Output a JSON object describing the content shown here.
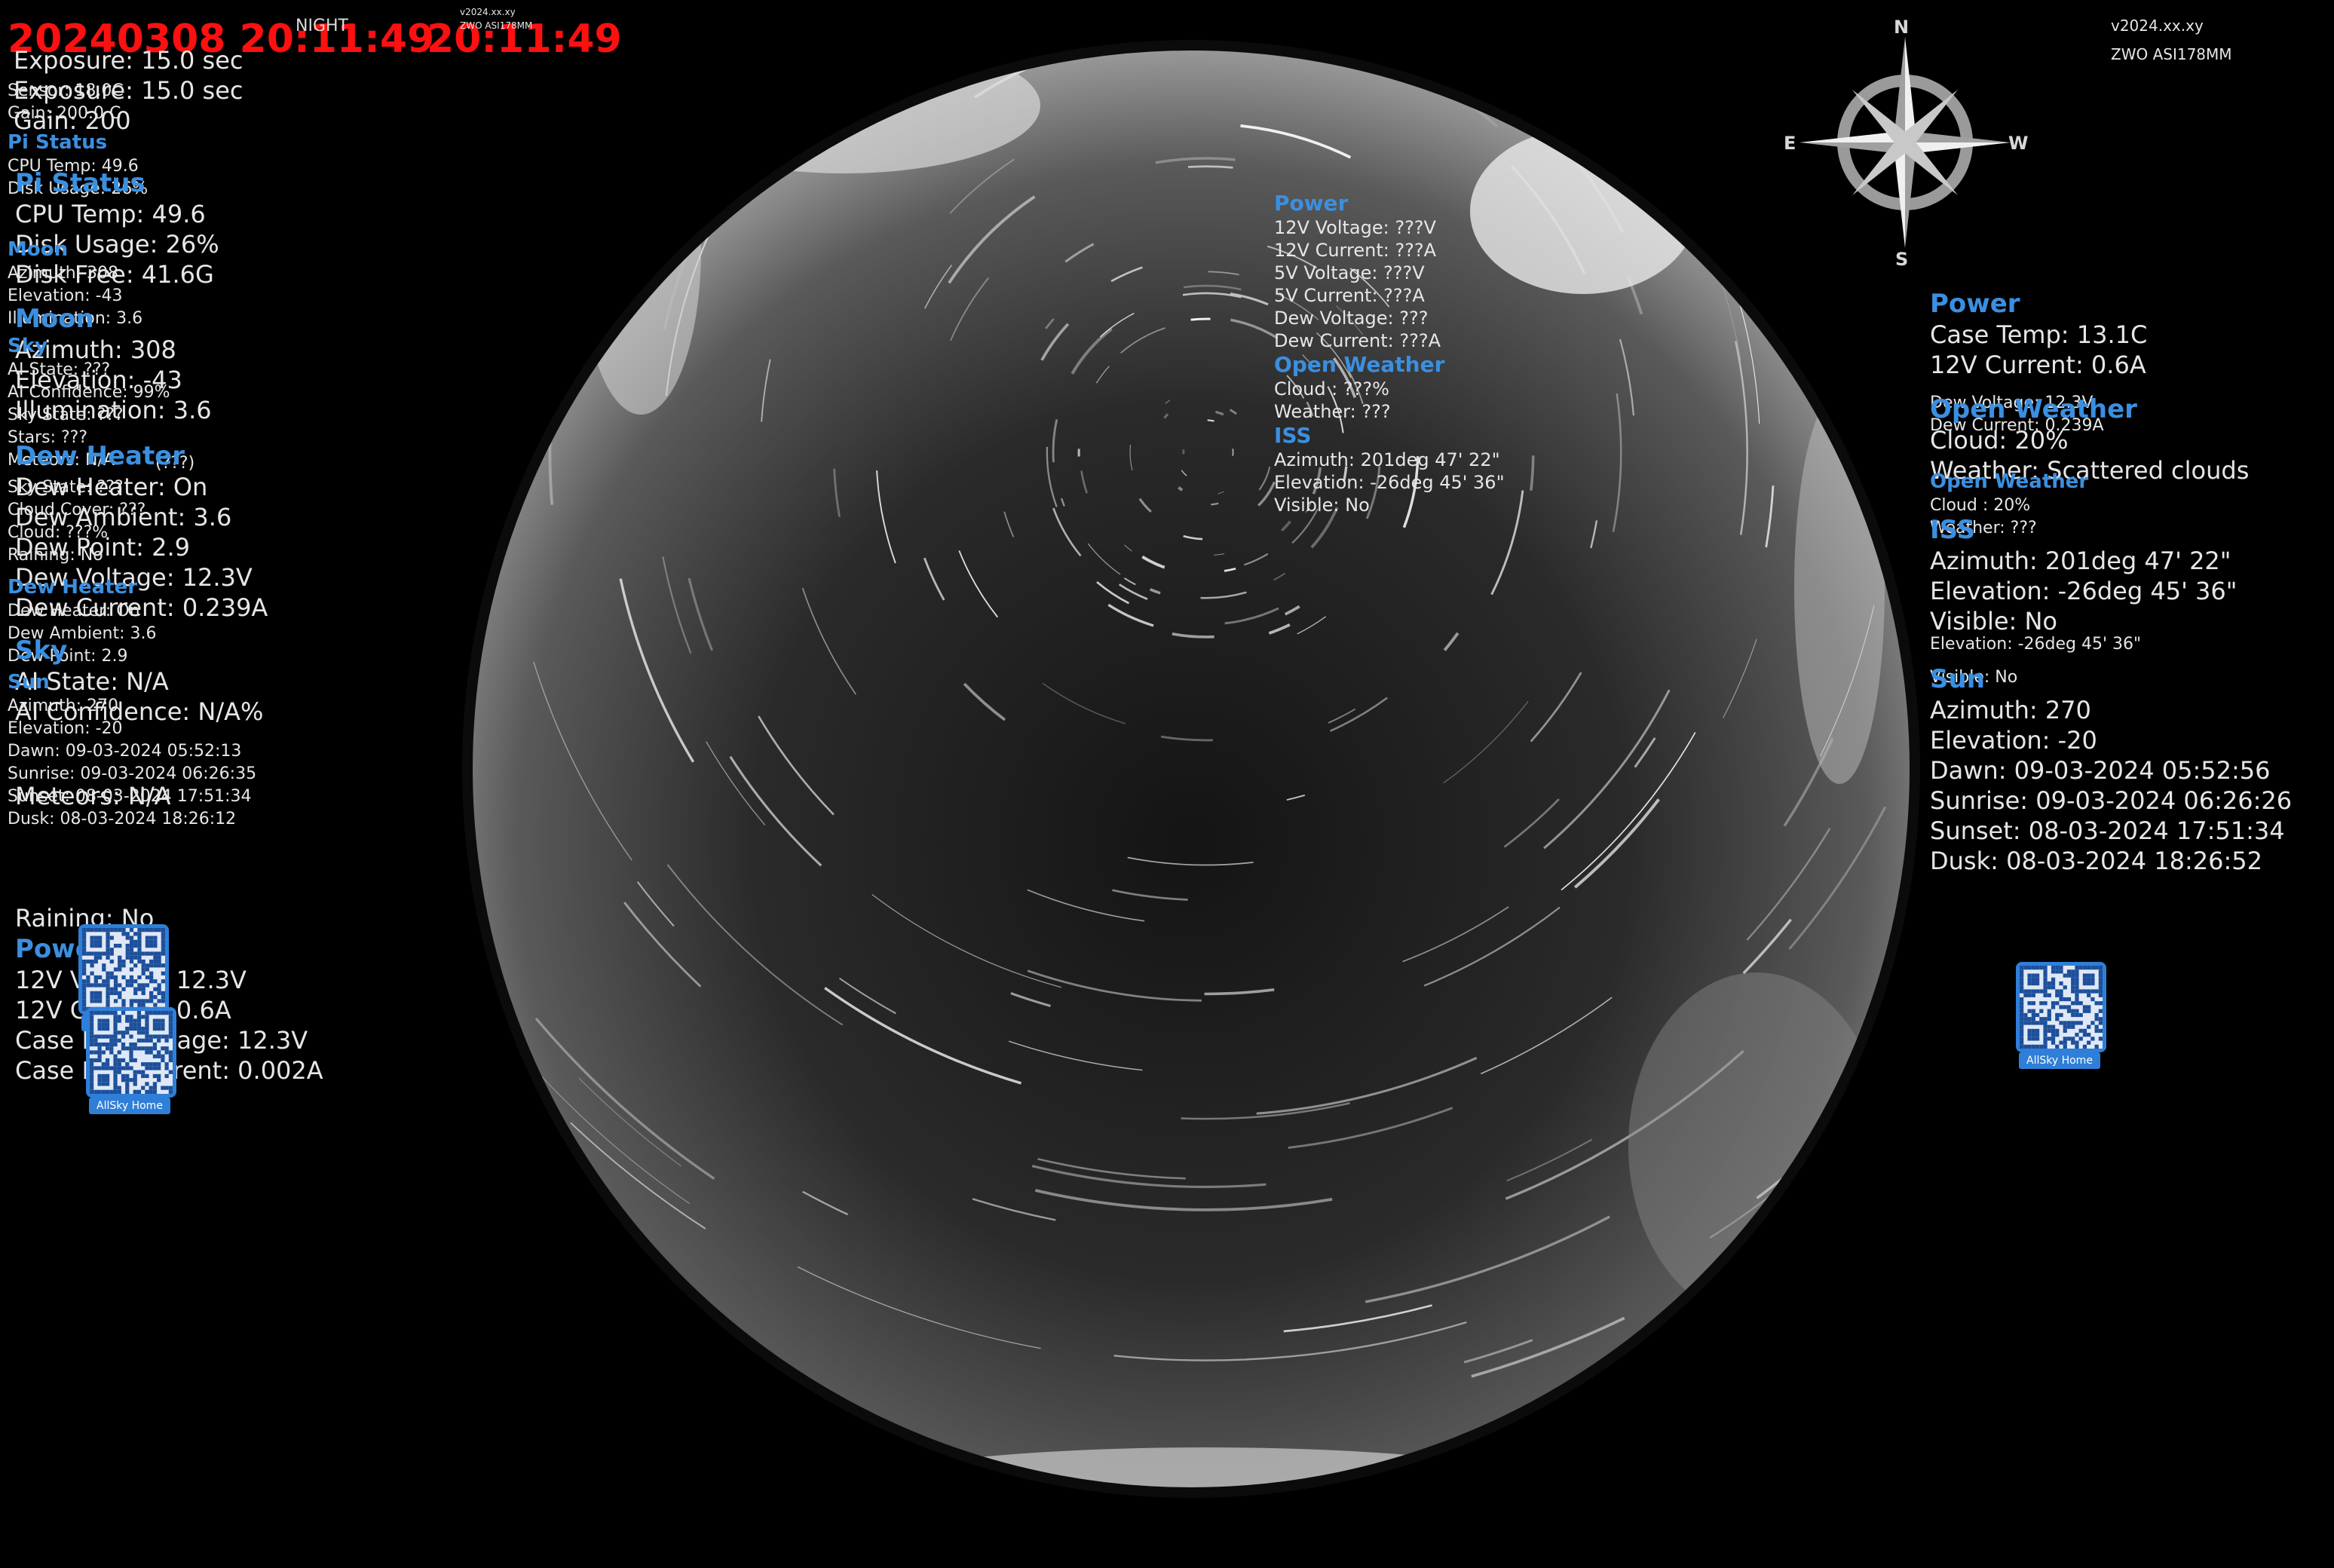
{
  "header": {
    "datetime": "20240308 20:11:49",
    "time_ghost": "20:11:49",
    "mode": "NIGHT",
    "version": "v2024.xx.xy",
    "camera": "ZWO ASI178MM"
  },
  "camera_info": {
    "exposure": "Exposure: 15.0 sec",
    "gain": "Gain: 200",
    "sensor_small": "Sensor: 18.0C",
    "gain_small": "Gain: 200.0 C"
  },
  "pi_status": {
    "heading": "Pi Status",
    "cpu_temp": "CPU Temp: 49.6",
    "disk_usage": "Disk Usage: 26%",
    "disk_free": "Disk Free: 41.6G",
    "cpu_temp_big": "CPU Temp: 49.6",
    "disk_usage_big": "Disk Usage: 26%",
    "disk_free_big": "Disk Free: 41.6G"
  },
  "moon": {
    "heading": "Moon",
    "azimuth": "Azimuth: 308",
    "elevation": "Elevation: -43",
    "illumination": "Illumination: 3.6",
    "azimuth_big": "Azimuth: 308",
    "elevation_big": "Elevation: -43",
    "illumination_big": "Illumination: 3.6"
  },
  "sky": {
    "heading": "Sky",
    "ai_state": "AI State: ???",
    "ai_confidence": "AI Confidence: 99%",
    "sky_state": "Sky State: ???",
    "stars": "Stars: ???",
    "meteors": "Meteors: N/A",
    "meteors_extra": "(???)",
    "ai_state_big": "AI State: N/A",
    "ai_confidence_big": "AI Confidence: N/A%",
    "meteors_big": "Meteors: N/A"
  },
  "dew_heater": {
    "heading": "Dew Heater",
    "dew_heater": "Dew Heater: On",
    "dew_ambient": "Dew Ambient: 3.6",
    "dew_point": "Dew Point: 2.9",
    "dew_voltage": "Dew Voltage: 12.3V",
    "dew_current": "Dew Current: 0.239A",
    "dew_heater_small": "Dew Heater: On",
    "dew_ambient_small": "Dew Ambient: 3.6",
    "dew_point_small": "Dew Point: 2.9"
  },
  "weather_small": {
    "sky_state": "Sky State: ???",
    "cloud_cover": "Cloud Cover: ???",
    "cloud": "Cloud: ???%",
    "raining": "Raining: No"
  },
  "sun_left": {
    "heading": "Sun",
    "azimuth": "Azimuth: 270",
    "elevation": "Elevation: -20",
    "dawn": "Dawn: 09-03-2024 05:52:13",
    "sunrise": "Sunrise: 09-03-2024 06:26:35",
    "sunset": "Sunset: 08-03-2024 17:51:34",
    "dusk": "Dusk: 08-03-2024 18:26:12"
  },
  "bottom_left": {
    "raining": "Raining: No",
    "power_heading": "Power",
    "v12": "12V Voltage: 12.3V",
    "i12": "12V Current: 0.6A",
    "case_fan_v": "Case Fan Voltage: 12.3V",
    "case_fan_i": "Case Fan Current: 0.002A",
    "qr_label": "AllSky Home"
  },
  "center_panel": {
    "power_heading": "Power",
    "v12": "12V Voltage: ???V",
    "i12": "12V Current: ???A",
    "v5": "5V Voltage: ???V",
    "i5": "5V Current: ???A",
    "dew_voltage": "Dew Voltage: ???",
    "dew_current": "Dew Current: ???A",
    "weather_heading": "Open Weather",
    "cloud": "Cloud : ???%",
    "weather": "Weather: ???",
    "iss_heading": "ISS",
    "iss_azimuth": "Azimuth: 201deg 47' 22\"",
    "iss_elevation": "Elevation: -26deg 45' 36\"",
    "iss_visible": "Visible: No"
  },
  "compass": {
    "n": "N",
    "s": "S",
    "e": "E",
    "w": "W"
  },
  "right_panel": {
    "power_heading": "Power",
    "case_temp": "Case Temp: 13.1C",
    "i12": "12V Current: 0.6A",
    "dew_voltage": "Dew Voltage: 12.3V",
    "dew_current": "Dew Current: 0.239A",
    "weather_heading": "Open Weather",
    "cloud": "Cloud: 20%",
    "weather": "Weather: Scattered clouds",
    "weather_small_heading": "Open Weather",
    "cloud_small": "Cloud : 20%",
    "weather_small": "Weather: ???",
    "iss_heading": "ISS",
    "iss_azimuth": "Azimuth: 201deg 47' 22\"",
    "iss_elevation": "Elevation: -26deg 45' 36\"",
    "iss_visible": "Visible: No",
    "iss_elevation_small": "Elevation: -26deg 45' 36\"",
    "iss_visible_small": "Visible: No",
    "sun_heading": "Sun",
    "sun_azimuth": "Azimuth: 270",
    "sun_elevation": "Elevation: -20",
    "dawn": "Dawn: 09-03-2024 05:52:56",
    "sunrise": "Sunrise: 09-03-2024 06:26:26",
    "sunset": "Sunset: 08-03-2024 17:51:34",
    "dusk": "Dusk: 08-03-2024 18:26:52",
    "qr_label": "AllSky Home"
  },
  "colors": {
    "heading": "#3b8fe0",
    "timestamp": "#ff1010",
    "qr_frame": "#2f7fd8"
  }
}
